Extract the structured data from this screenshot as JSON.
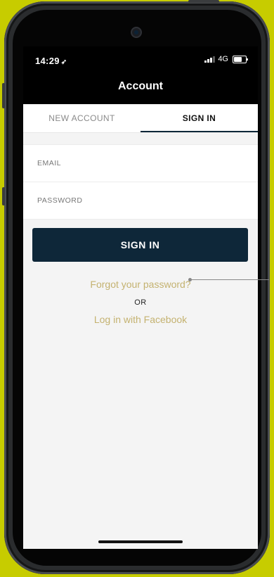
{
  "status_bar": {
    "time": "14:29",
    "location_icon": "location-arrow-icon",
    "network": "4G"
  },
  "nav": {
    "title": "Account"
  },
  "tabs": [
    {
      "label": "NEW ACCOUNT",
      "active": false
    },
    {
      "label": "SIGN IN",
      "active": true
    }
  ],
  "form": {
    "email_placeholder": "EMAIL",
    "password_placeholder": "PASSWORD",
    "submit_label": "SIGN IN"
  },
  "links": {
    "forgot": "Forgot your password?",
    "or": "OR",
    "facebook": "Log in with Facebook"
  },
  "colors": {
    "accent": "#c4b270",
    "primary": "#0e2739",
    "background": "#c7cc00"
  }
}
